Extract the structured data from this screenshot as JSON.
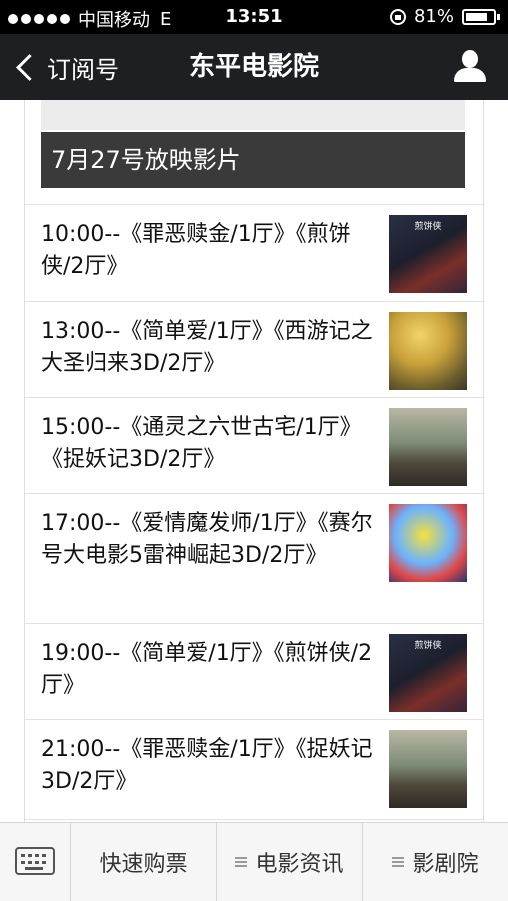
{
  "status_bar": {
    "carrier": "中国移动",
    "network": "E",
    "time": "13:51",
    "battery": "81%",
    "battery_level": 0.81
  },
  "nav": {
    "back_label": "订阅号",
    "title": "东平电影院"
  },
  "schedule": {
    "header": "7月27号放映影片",
    "rows": [
      {
        "text": "10:00--《罪恶赎金/1厅》《煎饼侠/2厅》",
        "poster": "煎饼侠"
      },
      {
        "text": "13:00--《简单爱/1厅》《西游记之大圣归来3D/2厅》",
        "poster": ""
      },
      {
        "text": "15:00--《通灵之六世古宅/1厅》《捉妖记3D/2厅》",
        "poster": ""
      },
      {
        "text": "17:00--《爱情魔发师/1厅》《赛尔号大电影5雷神崛起3D/2厅》",
        "poster": ""
      },
      {
        "text": "19:00--《简单爱/1厅》《煎饼侠/2厅》",
        "poster": "煎饼侠"
      },
      {
        "text": "21:00--《罪恶赎金/1厅》《捉妖记3D/2厅》",
        "poster": ""
      }
    ]
  },
  "tab_bar": {
    "tabs": [
      {
        "label": "快速购票"
      },
      {
        "label": "电影资讯"
      },
      {
        "label": "影剧院"
      }
    ]
  }
}
